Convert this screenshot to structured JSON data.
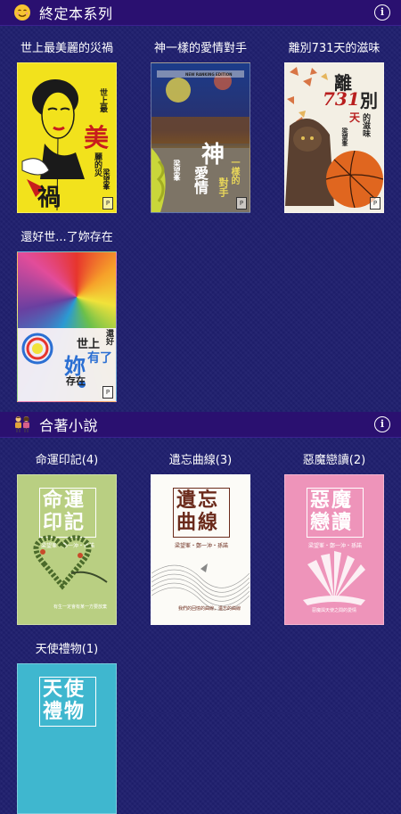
{
  "sections": [
    {
      "title": "終定本系列",
      "emoji_icon": "smiling-face-icon",
      "books": [
        {
          "label": "世上最美麗的災禍"
        },
        {
          "label": "神一樣的愛情對手"
        },
        {
          "label": "離別731天的滋味"
        },
        {
          "label": "還好世...了妳存在"
        }
      ]
    },
    {
      "title": "合著小說",
      "emoji_icon": "couple-icon",
      "books": [
        {
          "label": "命運印記(4)"
        },
        {
          "label": "遺忘曲線(3)"
        },
        {
          "label": "惡魔戀讀(2)"
        },
        {
          "label": "天使禮物(1)"
        }
      ]
    }
  ],
  "covers": {
    "c1": {
      "t1": "美",
      "t2": "禍",
      "small": "麗的災",
      "author": "梁望峯",
      "top": "世上最"
    },
    "c2": {
      "t1": "神",
      "t2": "愛情",
      "t3": "一樣的",
      "t4": "對手",
      "author": "梁望峯",
      "banner": "NEW RANKING EDITION"
    },
    "c3": {
      "t1": "離",
      "t2": "別",
      "num": "731",
      "t3": "天",
      "t4": "的滋味",
      "author": "梁望峯"
    },
    "c4": {
      "a": "世上",
      "b": "有了",
      "c": "妳",
      "d": "存在",
      "e": "還好",
      "author": "梁望峯"
    },
    "c5": {
      "t": "命運印記",
      "authors": "梁望峯・鄭一沖・孫諾",
      "blurb": "有生一定會有某一方要放棄"
    },
    "c6": {
      "t": "遺忘曲線",
      "authors": "梁望峯・鄭一沖・孫諾",
      "blurb": "我們的回憶的曲線，遺忘的曲線"
    },
    "c7": {
      "t": "惡魔戀讀",
      "authors": "梁望峯・鄭一沖・孫諾",
      "blurb": "惡魔與天使之間的愛情"
    },
    "c8": {
      "t": "天使禮物"
    }
  },
  "colors": {
    "header_bg": "#2a1070",
    "page_bg": "#1f1f6e"
  }
}
